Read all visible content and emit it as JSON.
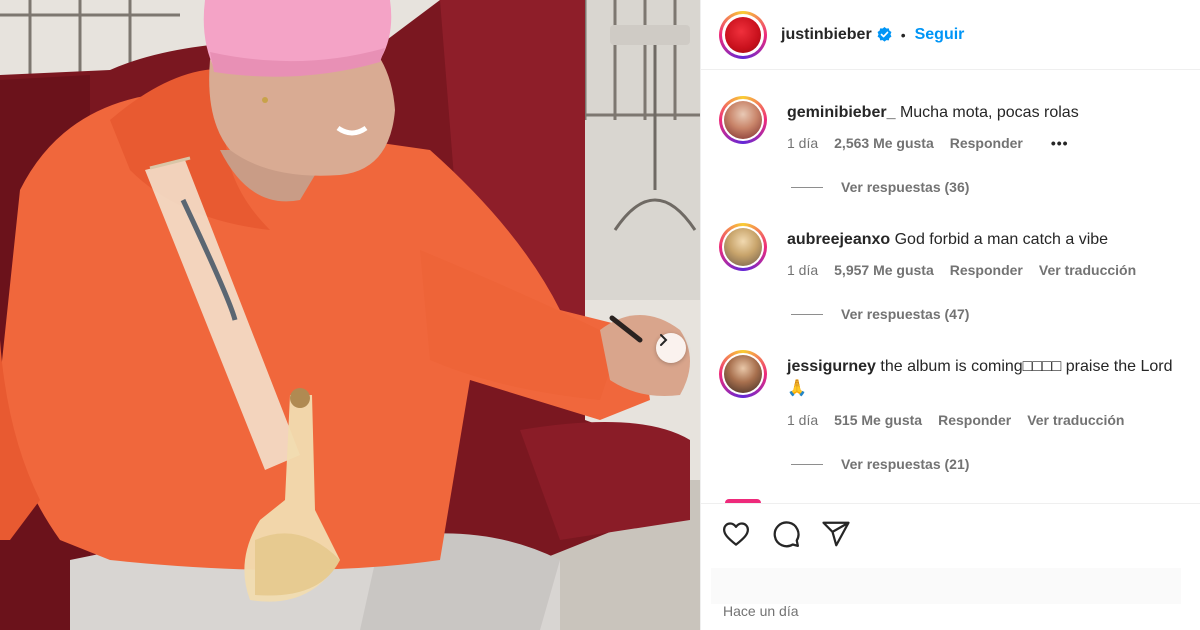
{
  "post": {
    "author": "justinbieber",
    "follow_label": "Seguir",
    "separator": "•",
    "timestamp": "Hace un día"
  },
  "colors": {
    "follow_blue": "#0095f6",
    "verified_blue": "#0095f6",
    "hoodie_orange": "#f0673c",
    "beanie_pink": "#f4a3c6",
    "chair_red": "#7a1720"
  },
  "comments": [
    {
      "user": "geminibieber_",
      "text": "Mucha mota, pocas rolas",
      "age": "1 día",
      "likes": "2,563 Me gusta",
      "reply": "Responder",
      "extra": "•••",
      "replies": "Ver respuestas (36)"
    },
    {
      "user": "aubreejeanxo",
      "text": "God forbid a man catch a vibe",
      "age": "1 día",
      "likes": "5,957 Me gusta",
      "reply": "Responder",
      "extra": "Ver traducción",
      "replies": "Ver respuestas (47)"
    },
    {
      "user": "jessigurney",
      "text": "the album is coming□□□□ praise the Lord",
      "text_line2": "🙏",
      "age": "1 día",
      "likes": "515 Me gusta",
      "reply": "Responder",
      "extra": "Ver traducción",
      "replies": "Ver respuestas (21)"
    }
  ],
  "icons": {
    "verified": "verified-badge-icon",
    "like": "heart-icon",
    "comment": "comment-bubble-icon",
    "share": "paper-plane-icon",
    "next": "chevron-right-icon"
  }
}
